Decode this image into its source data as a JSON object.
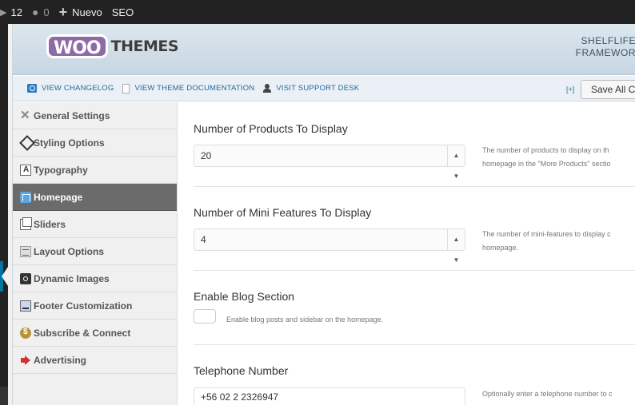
{
  "admin_bar": {
    "updates_count": "12",
    "comments_count": "0",
    "new_label": "Nuevo",
    "seo_label": "SEO"
  },
  "header": {
    "logo_woo": "WOO",
    "logo_themes": "THEMES",
    "theme_name_line1": "SHELFLIFE",
    "theme_name_line2": "FRAMEWOR"
  },
  "subbar": {
    "changelog": "View Changelog",
    "documentation": "View Theme Documentation",
    "support": "Visit Support Desk",
    "expand": "[+]",
    "save_all": "Save All Ch"
  },
  "nav": {
    "items": [
      {
        "label": "General Settings",
        "icon": "tools-icon"
      },
      {
        "label": "Styling Options",
        "icon": "paint-bucket-icon"
      },
      {
        "label": "Typography",
        "icon": "typography-icon"
      },
      {
        "label": "Homepage",
        "icon": "home-icon",
        "active": true
      },
      {
        "label": "Sliders",
        "icon": "slides-icon"
      },
      {
        "label": "Layout Options",
        "icon": "layout-icon"
      },
      {
        "label": "Dynamic Images",
        "icon": "camera-icon"
      },
      {
        "label": "Footer Customization",
        "icon": "footer-icon"
      },
      {
        "label": "Subscribe & Connect",
        "icon": "coins-icon"
      },
      {
        "label": "Advertising",
        "icon": "megaphone-icon"
      }
    ]
  },
  "settings": {
    "products": {
      "title": "Number of Products To Display",
      "value": "20",
      "desc_line1": "The number of products to display on th",
      "desc_line2": "homepage in the \"More Products\" sectio"
    },
    "mini_features": {
      "title": "Number of Mini Features To Display",
      "value": "4",
      "desc_line1": "The number of mini-features to display c",
      "desc_line2": "homepage."
    },
    "blog": {
      "title": "Enable Blog Section",
      "checkbox_label": "Enable blog posts and sidebar on the homepage.",
      "checked": false
    },
    "telephone": {
      "title": "Telephone Number",
      "value": "+56 02 2 2326947",
      "desc_line1": "Optionally enter a telephone number to c"
    }
  }
}
